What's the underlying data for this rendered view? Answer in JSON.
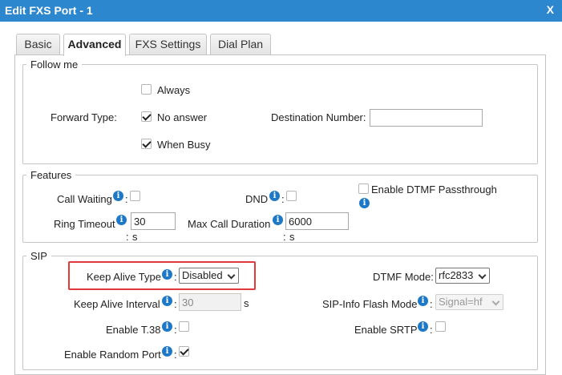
{
  "window": {
    "title": "Edit FXS Port - 1",
    "close_label": "X"
  },
  "tabs": [
    {
      "label": "Basic"
    },
    {
      "label": "Advanced"
    },
    {
      "label": "FXS Settings"
    },
    {
      "label": "Dial Plan"
    }
  ],
  "follow_me": {
    "legend": "Follow me",
    "forward_type_label": "Forward Type:",
    "options": [
      {
        "label": "Always",
        "checked": false
      },
      {
        "label": "No answer",
        "checked": true
      },
      {
        "label": "When Busy",
        "checked": true
      }
    ],
    "destination_label": "Destination Number:",
    "destination_value": ""
  },
  "features": {
    "legend": "Features",
    "call_waiting_label": "Call Waiting",
    "dnd_label": "DND",
    "dtmf_passthrough_label": "Enable DTMF Passthrough",
    "ring_timeout_label": "Ring Timeout",
    "ring_timeout_value": "30",
    "max_call_duration_label": "Max Call Duration",
    "max_call_duration_value": "6000",
    "unit_s": "s"
  },
  "sip": {
    "legend": "SIP",
    "keep_alive_type_label": "Keep Alive Type",
    "keep_alive_type_value": "Disabled",
    "dtmf_mode_label": "DTMF Mode:",
    "dtmf_mode_value": "rfc2833",
    "keep_alive_interval_label": "Keep Alive Interval",
    "keep_alive_interval_value": "30",
    "keep_alive_interval_unit": "s",
    "sip_info_flash_label": "SIP-Info Flash Mode",
    "sip_info_flash_value": "Signal=hf",
    "t38_label": "Enable T.38",
    "srtp_label": "Enable SRTP",
    "random_port_label": "Enable Random Port"
  },
  "colon": ":",
  "info_glyph": "i",
  "colors": {
    "titlebar": "#2c87cf",
    "info_icon": "#1e78c8",
    "highlight": "#e03a3a"
  }
}
